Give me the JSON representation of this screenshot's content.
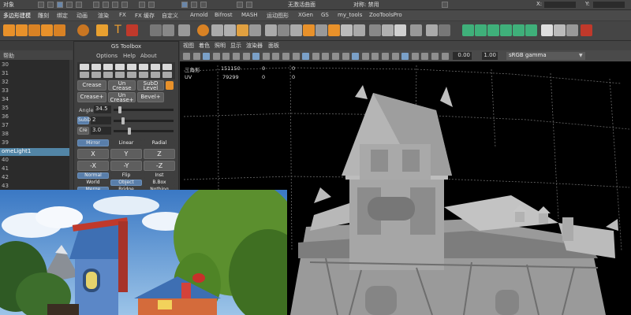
{
  "statusbar": {
    "mode_label": "对象",
    "no_live_surface": "无激活曲面",
    "symmetry": "对称: 禁用",
    "x_label": "X:",
    "y_label": "Y:"
  },
  "shelf_tabs": [
    "多边形建模",
    "雕刻",
    "绑定",
    "动画",
    "渲染",
    "FX",
    "FX 缓存",
    "自定义",
    "Arnold",
    "Bifrost",
    "MASH",
    "运动图形",
    "XGen",
    "GS",
    "my_tools",
    "ZooToolsPro"
  ],
  "outliner": {
    "header": "帮助",
    "rows": [
      "30",
      "31",
      "32",
      "33",
      "34",
      "35",
      "36",
      "37",
      "38",
      "39",
      "omeLight1",
      "40",
      "41",
      "42",
      "43"
    ],
    "selected_index": 10
  },
  "gs_toolbox": {
    "title": "GS Toolbox",
    "menu": [
      "Options",
      "Help",
      "About"
    ],
    "crease": "Crease",
    "uncrease": "Un\nCrease",
    "subd_level": "SubD\nLevel",
    "crease_plus": "Crease+",
    "uncrease_plus": "Un\nCrease+",
    "bevel_plus": "Bevel+",
    "angle_label": "Angle",
    "angle_value": "34.5",
    "subd_label": "SubD",
    "subd_value": "2",
    "cre_label": "Cre",
    "cre_value": "3.0",
    "mirror_row": [
      "Mirror",
      "Linear",
      "Radial"
    ],
    "axis_row1": [
      "X",
      "Y",
      "Z"
    ],
    "axis_row2": [
      "-X",
      "-Y",
      "-Z"
    ],
    "mode_row1": [
      "Normal",
      "Flip",
      "Inst"
    ],
    "mode_row2": [
      "World",
      "Object",
      "B.Box"
    ],
    "mode_row3": [
      "Merge",
      "Bridge",
      "Nothing"
    ]
  },
  "viewport": {
    "menu": [
      "视图",
      "着色",
      "照明",
      "显示",
      "渲染器",
      "面板"
    ],
    "exposure": "0.00",
    "gamma": "1.00",
    "colorspace": "sRGB gamma",
    "hud": [
      {
        "label": "三角形",
        "a": "151150",
        "b": "0",
        "c": "0"
      },
      {
        "label": "UV",
        "a": "79299",
        "b": "0",
        "c": "0"
      }
    ]
  },
  "colors": {
    "ui_bg": "#3c3c3c",
    "selection": "#5285a6",
    "gs_blue": "#597eaa",
    "model_grey": "#a9a9a9"
  }
}
